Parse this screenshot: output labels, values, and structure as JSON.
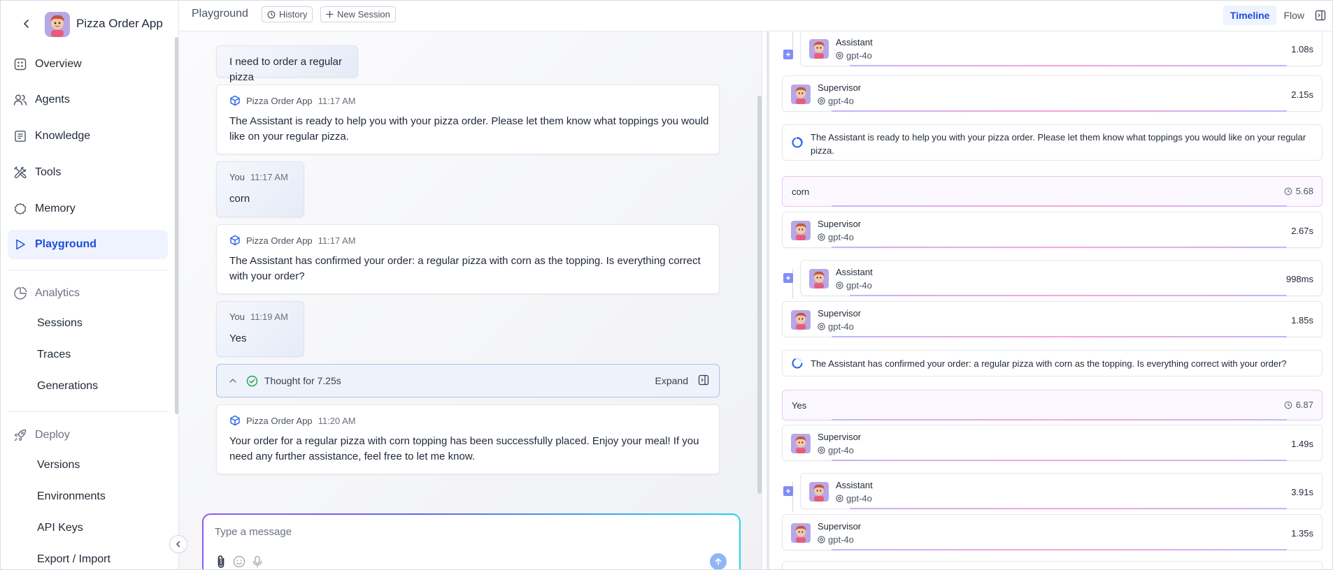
{
  "app": {
    "name": "Pizza Order App"
  },
  "sidebar": {
    "nav": [
      {
        "label": "Overview",
        "icon": "grid-icon"
      },
      {
        "label": "Agents",
        "icon": "users-icon"
      },
      {
        "label": "Knowledge",
        "icon": "book-icon"
      },
      {
        "label": "Tools",
        "icon": "tools-icon"
      },
      {
        "label": "Memory",
        "icon": "cog-icon"
      },
      {
        "label": "Playground",
        "icon": "play-icon"
      }
    ],
    "analytics": {
      "label": "Analytics",
      "items": [
        "Sessions",
        "Traces",
        "Generations"
      ]
    },
    "deploy": {
      "label": "Deploy",
      "items": [
        "Versions",
        "Environments",
        "API Keys",
        "Export / Import"
      ]
    }
  },
  "topbar": {
    "title": "Playground",
    "history_label": "History",
    "new_session_label": "New Session",
    "timeline_label": "Timeline",
    "flow_label": "Flow"
  },
  "chat": {
    "messages": [
      {
        "role": "user",
        "text": "I need to order a regular pizza"
      },
      {
        "role": "app",
        "author": "Pizza Order App",
        "time": "11:17 AM",
        "text": "The Assistant is ready to help you with your pizza order. Please let them know what toppings you would like on your regular pizza."
      },
      {
        "role": "user",
        "author": "You",
        "time": "11:17 AM",
        "text": "corn"
      },
      {
        "role": "app",
        "author": "Pizza Order App",
        "time": "11:17 AM",
        "text": "The Assistant has confirmed your order: a regular pizza with corn as the topping. Is everything correct with your order?"
      },
      {
        "role": "user",
        "author": "You",
        "time": "11:19 AM",
        "text": "Yes"
      },
      {
        "role": "app",
        "author": "Pizza Order App",
        "time": "11:20 AM",
        "text": "Your order for a regular pizza with corn topping has been successfully placed. Enjoy your meal! If you need any further assistance, feel free to let me know."
      }
    ],
    "thought": {
      "label": "Thought for 7.25s",
      "expand_label": "Expand"
    },
    "composer": {
      "placeholder": "Type a message"
    }
  },
  "timeline": {
    "entries": [
      {
        "kind": "agent",
        "name": "Assistant",
        "model": "gpt-4o",
        "duration": "1.08s",
        "nested": true
      },
      {
        "kind": "agent",
        "name": "Supervisor",
        "model": "gpt-4o",
        "duration": "2.15s",
        "nested": false
      },
      {
        "kind": "message",
        "text": "The Assistant is ready to help you with your pizza order. Please let them know what toppings you would like on your regular pizza."
      },
      {
        "kind": "user",
        "text": "corn",
        "time": "5.68"
      },
      {
        "kind": "agent",
        "name": "Supervisor",
        "model": "gpt-4o",
        "duration": "2.67s",
        "nested": false
      },
      {
        "kind": "agent",
        "name": "Assistant",
        "model": "gpt-4o",
        "duration": "998ms",
        "nested": true
      },
      {
        "kind": "agent",
        "name": "Supervisor",
        "model": "gpt-4o",
        "duration": "1.85s",
        "nested": false
      },
      {
        "kind": "message",
        "text": "The Assistant has confirmed your order: a regular pizza with corn as the topping. Is everything correct with your order?"
      },
      {
        "kind": "user",
        "text": "Yes",
        "time": "6.87"
      },
      {
        "kind": "agent",
        "name": "Supervisor",
        "model": "gpt-4o",
        "duration": "1.49s",
        "nested": false
      },
      {
        "kind": "agent",
        "name": "Assistant",
        "model": "gpt-4o",
        "duration": "3.91s",
        "nested": true
      },
      {
        "kind": "agent",
        "name": "Supervisor",
        "model": "gpt-4o",
        "duration": "1.35s",
        "nested": false
      }
    ]
  },
  "colors": {
    "accent": "#1d4ed8",
    "active_bg": "#eef3ff",
    "plus_box": "#818cf8",
    "user_border": "#e9c7f1"
  }
}
